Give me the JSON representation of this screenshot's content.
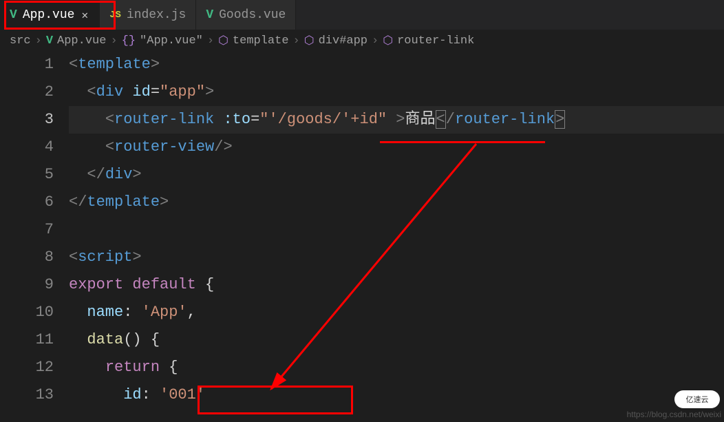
{
  "tabs": [
    {
      "icon": "vue",
      "label": "App.vue",
      "active": true,
      "closeable": true
    },
    {
      "icon": "js",
      "label": "index.js",
      "active": false,
      "closeable": false
    },
    {
      "icon": "vue",
      "label": "Goods.vue",
      "active": false,
      "closeable": false
    }
  ],
  "breadcrumbs": {
    "items": [
      "src",
      "App.vue",
      "\"App.vue\"",
      "template",
      "div#app",
      "router-link"
    ],
    "sep": "›"
  },
  "gutter": [
    "1",
    "2",
    "3",
    "4",
    "5",
    "6",
    "7",
    "8",
    "9",
    "10",
    "11",
    "12",
    "13"
  ],
  "code": {
    "l1": {
      "open": "<",
      "tag": "template",
      "close": ">"
    },
    "l2": {
      "open": "<",
      "tag": "div",
      "attr": "id",
      "eq": "=",
      "val": "\"app\"",
      "close": ">"
    },
    "l3": {
      "open": "<",
      "tag": "router-link",
      "attr": ":to",
      "eq": "=",
      "val": "\"'/goods/'+id\"",
      "mid": " >",
      "text": "商品",
      "copen": "<",
      "slash": "/",
      "ctag": "router-link",
      "cclose": ">"
    },
    "l4": {
      "open": "<",
      "tag": "router-view",
      "close": "/>"
    },
    "l5": {
      "open": "</",
      "tag": "div",
      "close": ">"
    },
    "l6": {
      "open": "</",
      "tag": "template",
      "close": ">"
    },
    "l8": {
      "open": "<",
      "tag": "script",
      "close": ">"
    },
    "l9": {
      "kw": "export",
      "kw2": "default",
      "brace": " {"
    },
    "l10": {
      "prop": "name",
      "colon": ": ",
      "val": "'App'",
      "comma": ","
    },
    "l11": {
      "func": "data",
      "paren": "()",
      "brace": " {"
    },
    "l12": {
      "kw": "return",
      "brace": " {"
    },
    "l13": {
      "prop": "id",
      "colon": ": ",
      "val": "'001'"
    }
  },
  "watermark": {
    "url": "https://blog.csdn.net/weixi",
    "logo": "亿速云"
  }
}
